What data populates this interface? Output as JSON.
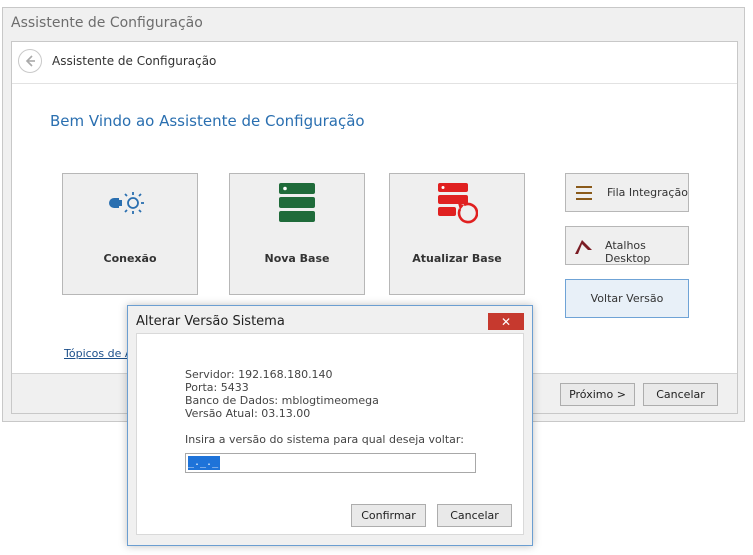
{
  "window": {
    "title": "Assistente de Configuração"
  },
  "header": {
    "title": "Assistente de Configuração"
  },
  "welcome": "Bem Vindo ao Assistente de Configuração",
  "tiles": [
    {
      "label": "Conexão",
      "icon": "connection-icon"
    },
    {
      "label": "Nova Base",
      "icon": "database-icon"
    },
    {
      "label": "Atualizar Base",
      "icon": "database-refresh-icon"
    }
  ],
  "side_buttons": {
    "fila": "Fila Integração",
    "atalhos": "Atalhos Desktop",
    "voltar": "Voltar Versão"
  },
  "help_link": "Tópicos de Aj",
  "footer": {
    "next": "Próximo >",
    "cancel": "Cancelar"
  },
  "dialog": {
    "title": "Alterar Versão Sistema",
    "close": "✕",
    "servidor": "Servidor: 192.168.180.140",
    "porta": "Porta: 5433",
    "banco": "Banco de Dados: mblogtimeomega",
    "versao": "Versão Atual: 03.13.00",
    "prompt": "Insira a versão do sistema para qual deseja voltar:",
    "input_value": "_._._",
    "confirm": "Confirmar",
    "cancel": "Cancelar"
  },
  "colors": {
    "accent": "#2a6fb0",
    "green": "#1f6b3a",
    "red": "#e02020",
    "close": "#c6392e"
  }
}
